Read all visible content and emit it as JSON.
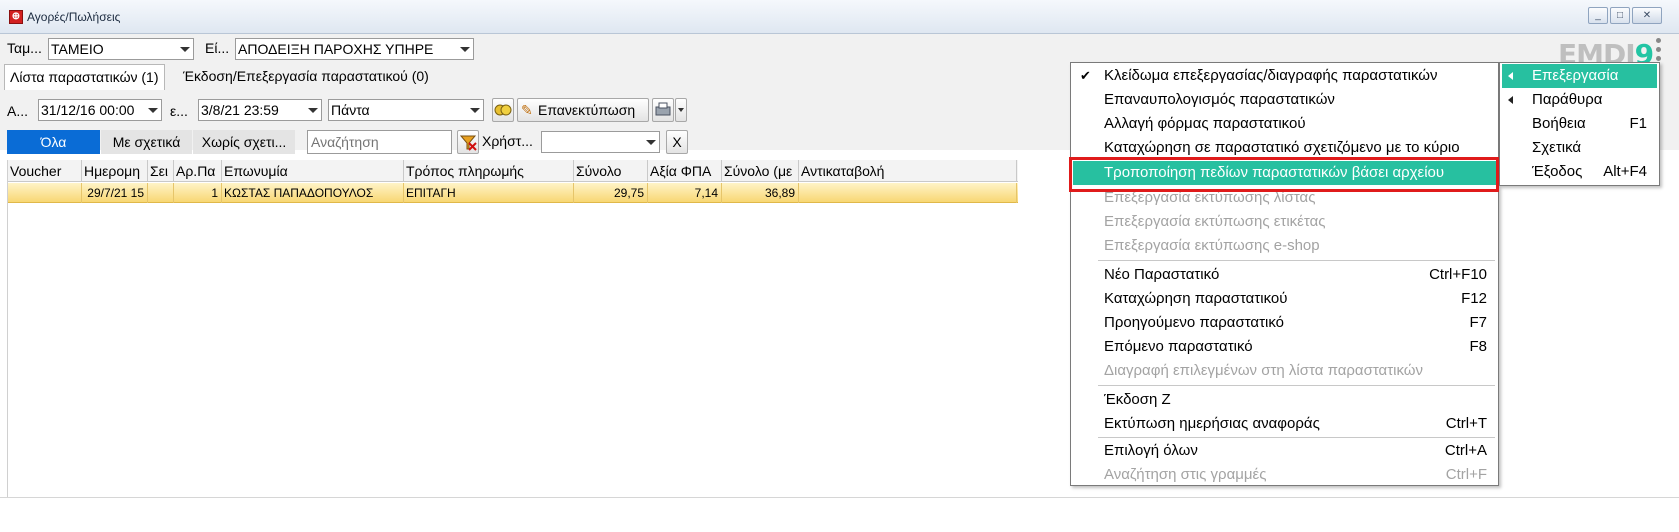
{
  "window": {
    "title": "Αγορές/Πωλήσεις",
    "min": "_",
    "max": "□",
    "close": "✕"
  },
  "filters": {
    "cash_label": "Ταμ...",
    "cash_value": "ΤΑΜΕΙΟ",
    "type_label": "Εί...",
    "type_value": "ΑΠΟΔΕΙΞΗ ΠΑΡΟΧΗΣ ΥΠΗΡΕ",
    "from_label": "Α...",
    "from_value": "31/12/16 00:00",
    "to_label": "ε...",
    "to_value": "3/8/21 23:59",
    "period_value": "Πάντα",
    "reprint_label": "Επανεκτύπωση",
    "user_label": "Χρήστ...",
    "clear": "X"
  },
  "logo": {
    "part1": "EMDI",
    "part2": "9"
  },
  "tabs": [
    "Λίστα παραστατικών (1)",
    "Έκδοση/Επεξεργασία παραστατικού (0)"
  ],
  "segments": [
    "Όλα",
    "Με σχετικά",
    "Χωρίς σχετι..."
  ],
  "search": {
    "placeholder": "Αναζήτηση"
  },
  "table": {
    "headers": [
      "Voucher",
      "Ημερομη",
      "Σει",
      "Αρ.Πα",
      "Επωνυμία",
      "Τρόπος πληρωμής",
      "Σύνολο",
      "Αξία ΦΠΑ",
      "Σύνολο (με",
      "Αντικαταβολή"
    ],
    "rows": [
      {
        "voucher": "",
        "date": "29/7/21 15",
        "series": "",
        "number": "1",
        "name": "ΚΩΣΤΑΣ ΠΑΠΑΔΟΠΟΥΛΟΣ",
        "payment": "ΕΠΙΤΑΓΗ",
        "total": "29,75",
        "vat": "7,14",
        "total_vat": "36,89",
        "cod": ""
      }
    ]
  },
  "context_menu": {
    "items": [
      {
        "label": "Κλείδωμα επεξεργασίας/διαγραφής παραστατικών",
        "shortcut": "",
        "checked": true
      },
      {
        "label": "Επαναυπολογισμός παραστατικών",
        "shortcut": ""
      },
      {
        "label": "Αλλαγή φόρμας παραστατικού",
        "shortcut": ""
      },
      {
        "label": "Καταχώρηση σε παραστατικό σχετιζόμενο με το κύριο",
        "shortcut": ""
      },
      {
        "label": "Τροποποίηση πεδίων παραστατικών βάσει αρχείου",
        "shortcut": "",
        "highlighted": true
      },
      {
        "label": "Επεξεργασία εκτύπωσης λίστας",
        "shortcut": "",
        "disabled": true
      },
      {
        "label": "Επεξεργασία εκτύπωσης ετικέτας",
        "shortcut": "",
        "disabled": true
      },
      {
        "label": "Επεξεργασία εκτύπωσης e-shop",
        "shortcut": "",
        "disabled": true
      },
      {
        "label": "Νέο Παραστατικό",
        "shortcut": "Ctrl+F10"
      },
      {
        "label": "Καταχώρηση παραστατικού",
        "shortcut": "F12"
      },
      {
        "label": "Προηγούμενο παραστατικό",
        "shortcut": "F7"
      },
      {
        "label": "Επόμενο παραστατικό",
        "shortcut": "F8"
      },
      {
        "label": "Διαγραφή επιλεγμένων στη λίστα παραστατικών",
        "shortcut": "",
        "disabled": true
      },
      {
        "label": "Έκδοση Ζ",
        "shortcut": ""
      },
      {
        "label": "Εκτύπωση ημερήσιας αναφοράς",
        "shortcut": "Ctrl+T"
      },
      {
        "label": "Επιλογή όλων",
        "shortcut": "Ctrl+A"
      },
      {
        "label": "Αναζήτηση στις γραμμές",
        "shortcut": "Ctrl+F",
        "disabled": true
      }
    ]
  },
  "side_menu": {
    "items": [
      {
        "label": "Επεξεργασία",
        "shortcut": "",
        "arrow": true,
        "highlighted": true
      },
      {
        "label": "Παράθυρα",
        "shortcut": "",
        "arrow": true
      },
      {
        "label": "Βοήθεια",
        "shortcut": "F1"
      },
      {
        "label": "Σχετικά",
        "shortcut": ""
      },
      {
        "label": "Έξοδος",
        "shortcut": "Alt+F4"
      }
    ]
  },
  "colors": {
    "accent": "#27c0a0",
    "selected_row": "#f8d774",
    "segment_active": "#0a6cd6",
    "highlight_border": "#e01b1b"
  }
}
